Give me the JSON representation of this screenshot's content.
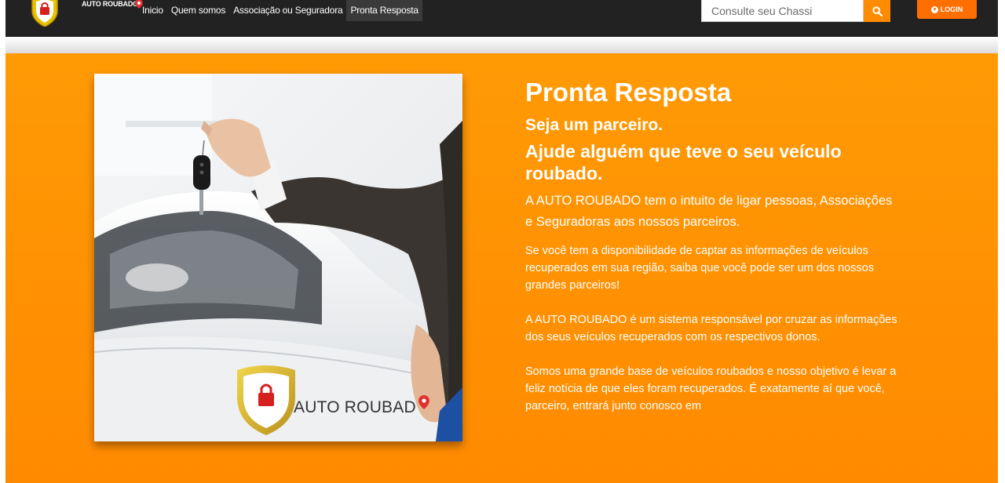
{
  "navbar": {
    "logo_text": "AUTO ROUBADO",
    "links": [
      {
        "label": "Inicio",
        "active": false
      },
      {
        "label": "Quem somos",
        "active": false
      },
      {
        "label": "Associação ou Seguradora",
        "active": false
      },
      {
        "label": "Pronta Resposta",
        "active": true
      }
    ],
    "search": {
      "placeholder": "Consulte seu Chassi",
      "value": ""
    },
    "search_icon": "search-icon",
    "login": {
      "label": "LOGIN",
      "icon": "user-circle-icon"
    }
  },
  "hero": {
    "title": "Pronta Resposta",
    "subtitle": "Seja um parceiro.",
    "tagline": "Ajude alguém que teve o seu veículo roubado.",
    "lead": "A AUTO ROUBADO tem o intuito de ligar pessoas, Associações e Seguradoras aos nossos parceiros.",
    "paragraphs": [
      "Se você tem a disponibilidade de captar as informações de veículos recuperados em sua região, saiba que você pode ser um dos nossos grandes parceiros!",
      "A AUTO ROUBADO é um sistema responsável por cruzar as informações dos seus veículos recuperados com os respectivos donos.",
      "Somos uma grande base de veículos roubados e nosso objetivo é levar a feliz notícia de que eles foram recuperados. É exatamente aí que você, parceiro, entrará junto conosco em"
    ],
    "image_logo_text": "AUTO ROUBAD"
  },
  "colors": {
    "navbar_bg": "#222222",
    "accent": "#ff8c00",
    "login_bg": "#ff6f00",
    "hero_bg": "#ff9a05",
    "text_on_hero": "#ffffff"
  }
}
